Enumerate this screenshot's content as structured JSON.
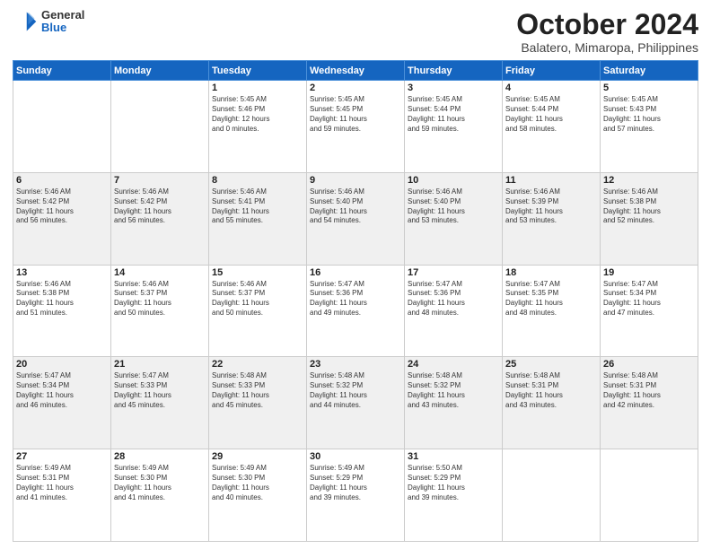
{
  "header": {
    "logo_general": "General",
    "logo_blue": "Blue",
    "month_title": "October 2024",
    "subtitle": "Balatero, Mimaropa, Philippines"
  },
  "weekdays": [
    "Sunday",
    "Monday",
    "Tuesday",
    "Wednesday",
    "Thursday",
    "Friday",
    "Saturday"
  ],
  "weeks": [
    [
      {
        "day": "",
        "info": ""
      },
      {
        "day": "",
        "info": ""
      },
      {
        "day": "1",
        "info": "Sunrise: 5:45 AM\nSunset: 5:46 PM\nDaylight: 12 hours\nand 0 minutes."
      },
      {
        "day": "2",
        "info": "Sunrise: 5:45 AM\nSunset: 5:45 PM\nDaylight: 11 hours\nand 59 minutes."
      },
      {
        "day": "3",
        "info": "Sunrise: 5:45 AM\nSunset: 5:44 PM\nDaylight: 11 hours\nand 59 minutes."
      },
      {
        "day": "4",
        "info": "Sunrise: 5:45 AM\nSunset: 5:44 PM\nDaylight: 11 hours\nand 58 minutes."
      },
      {
        "day": "5",
        "info": "Sunrise: 5:45 AM\nSunset: 5:43 PM\nDaylight: 11 hours\nand 57 minutes."
      }
    ],
    [
      {
        "day": "6",
        "info": "Sunrise: 5:46 AM\nSunset: 5:42 PM\nDaylight: 11 hours\nand 56 minutes."
      },
      {
        "day": "7",
        "info": "Sunrise: 5:46 AM\nSunset: 5:42 PM\nDaylight: 11 hours\nand 56 minutes."
      },
      {
        "day": "8",
        "info": "Sunrise: 5:46 AM\nSunset: 5:41 PM\nDaylight: 11 hours\nand 55 minutes."
      },
      {
        "day": "9",
        "info": "Sunrise: 5:46 AM\nSunset: 5:40 PM\nDaylight: 11 hours\nand 54 minutes."
      },
      {
        "day": "10",
        "info": "Sunrise: 5:46 AM\nSunset: 5:40 PM\nDaylight: 11 hours\nand 53 minutes."
      },
      {
        "day": "11",
        "info": "Sunrise: 5:46 AM\nSunset: 5:39 PM\nDaylight: 11 hours\nand 53 minutes."
      },
      {
        "day": "12",
        "info": "Sunrise: 5:46 AM\nSunset: 5:38 PM\nDaylight: 11 hours\nand 52 minutes."
      }
    ],
    [
      {
        "day": "13",
        "info": "Sunrise: 5:46 AM\nSunset: 5:38 PM\nDaylight: 11 hours\nand 51 minutes."
      },
      {
        "day": "14",
        "info": "Sunrise: 5:46 AM\nSunset: 5:37 PM\nDaylight: 11 hours\nand 50 minutes."
      },
      {
        "day": "15",
        "info": "Sunrise: 5:46 AM\nSunset: 5:37 PM\nDaylight: 11 hours\nand 50 minutes."
      },
      {
        "day": "16",
        "info": "Sunrise: 5:47 AM\nSunset: 5:36 PM\nDaylight: 11 hours\nand 49 minutes."
      },
      {
        "day": "17",
        "info": "Sunrise: 5:47 AM\nSunset: 5:36 PM\nDaylight: 11 hours\nand 48 minutes."
      },
      {
        "day": "18",
        "info": "Sunrise: 5:47 AM\nSunset: 5:35 PM\nDaylight: 11 hours\nand 48 minutes."
      },
      {
        "day": "19",
        "info": "Sunrise: 5:47 AM\nSunset: 5:34 PM\nDaylight: 11 hours\nand 47 minutes."
      }
    ],
    [
      {
        "day": "20",
        "info": "Sunrise: 5:47 AM\nSunset: 5:34 PM\nDaylight: 11 hours\nand 46 minutes."
      },
      {
        "day": "21",
        "info": "Sunrise: 5:47 AM\nSunset: 5:33 PM\nDaylight: 11 hours\nand 45 minutes."
      },
      {
        "day": "22",
        "info": "Sunrise: 5:48 AM\nSunset: 5:33 PM\nDaylight: 11 hours\nand 45 minutes."
      },
      {
        "day": "23",
        "info": "Sunrise: 5:48 AM\nSunset: 5:32 PM\nDaylight: 11 hours\nand 44 minutes."
      },
      {
        "day": "24",
        "info": "Sunrise: 5:48 AM\nSunset: 5:32 PM\nDaylight: 11 hours\nand 43 minutes."
      },
      {
        "day": "25",
        "info": "Sunrise: 5:48 AM\nSunset: 5:31 PM\nDaylight: 11 hours\nand 43 minutes."
      },
      {
        "day": "26",
        "info": "Sunrise: 5:48 AM\nSunset: 5:31 PM\nDaylight: 11 hours\nand 42 minutes."
      }
    ],
    [
      {
        "day": "27",
        "info": "Sunrise: 5:49 AM\nSunset: 5:31 PM\nDaylight: 11 hours\nand 41 minutes."
      },
      {
        "day": "28",
        "info": "Sunrise: 5:49 AM\nSunset: 5:30 PM\nDaylight: 11 hours\nand 41 minutes."
      },
      {
        "day": "29",
        "info": "Sunrise: 5:49 AM\nSunset: 5:30 PM\nDaylight: 11 hours\nand 40 minutes."
      },
      {
        "day": "30",
        "info": "Sunrise: 5:49 AM\nSunset: 5:29 PM\nDaylight: 11 hours\nand 39 minutes."
      },
      {
        "day": "31",
        "info": "Sunrise: 5:50 AM\nSunset: 5:29 PM\nDaylight: 11 hours\nand 39 minutes."
      },
      {
        "day": "",
        "info": ""
      },
      {
        "day": "",
        "info": ""
      }
    ]
  ]
}
